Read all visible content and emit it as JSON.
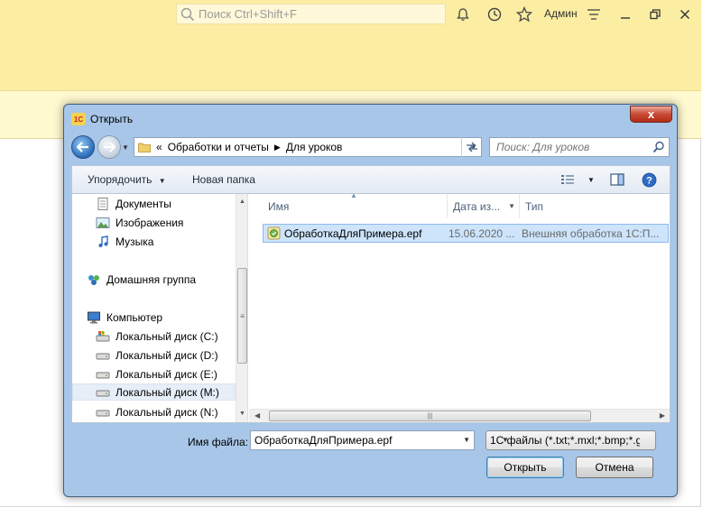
{
  "app": {
    "search_placeholder": "Поиск Ctrl+Shift+F",
    "user_name": "Админ",
    "icons": [
      "bell-icon",
      "history-icon",
      "star-icon",
      "menu-icon",
      "minimize-icon",
      "restore-icon",
      "close-icon"
    ]
  },
  "dialog": {
    "title": "Открыть",
    "close_label": "x",
    "address": {
      "prefix": "«",
      "crumbs": [
        "Обработки и отчеты",
        "Для уроков"
      ]
    },
    "search_placeholder": "Поиск: Для уроков",
    "toolbar": {
      "organize": "Упорядочить",
      "new_folder": "Новая папка"
    },
    "nav_items": [
      {
        "label": "Документы",
        "icon": "documents-icon"
      },
      {
        "label": "Изображения",
        "icon": "pictures-icon"
      },
      {
        "label": "Музыка",
        "icon": "music-icon"
      },
      {
        "label": "Домашняя группа",
        "icon": "homegroup-icon"
      },
      {
        "label": "Компьютер",
        "icon": "computer-icon"
      },
      {
        "label": "Локальный диск (C:)",
        "icon": "system-drive-icon"
      },
      {
        "label": "Локальный диск (D:)",
        "icon": "drive-icon"
      },
      {
        "label": "Локальный диск (E:)",
        "icon": "drive-icon"
      },
      {
        "label": "Локальный диск (M:)",
        "icon": "drive-icon",
        "selected": true
      },
      {
        "label": "Локальный диск (N:)",
        "icon": "drive-icon"
      }
    ],
    "columns": {
      "name": "Имя",
      "date": "Дата из...",
      "type": "Тип"
    },
    "files": [
      {
        "name": "ОбработкаДляПримера.epf",
        "date": "15.06.2020 ...",
        "type": "Внешняя обработка 1С:П..."
      }
    ],
    "filename_label": "Имя файла:",
    "filename_value": "ОбработкаДляПримера.epf",
    "filter_value": "1С файлы (*.txt;*.mxl;*.bmp;*.g",
    "open_button": "Открыть",
    "cancel_button": "Отмена"
  },
  "colors": {
    "app_yellow": "#fbeda2",
    "dialog_frame": "#a8c6e8",
    "selection": "#cde4fb"
  }
}
